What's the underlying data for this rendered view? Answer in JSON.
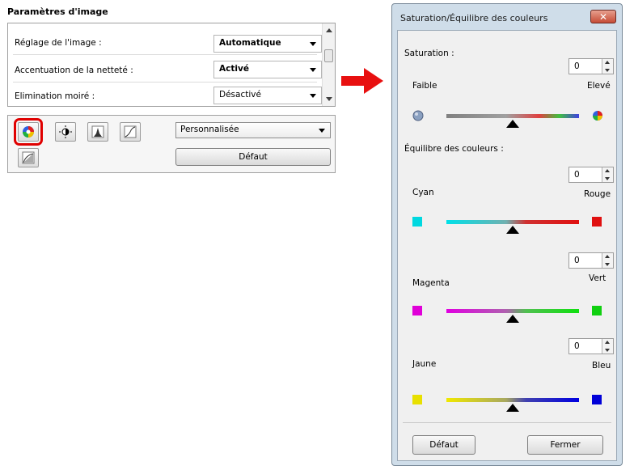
{
  "left_panel": {
    "title": "Paramètres d'image",
    "rows": [
      {
        "label": "Réglage de l'image :",
        "value": "Automatique"
      },
      {
        "label": "Accentuation de la netteté :",
        "value": "Activé"
      },
      {
        "label": "Elimination moiré :",
        "value": "Désactivé"
      }
    ],
    "tools": [
      "saturation-color-balance-icon",
      "brightness-contrast-icon",
      "histogram-icon",
      "tone-curve-icon",
      "final-review-icon"
    ],
    "preset_select": "Personnalisée",
    "default_button": "Défaut"
  },
  "dialog": {
    "title": "Saturation/Équilibre des couleurs",
    "saturation_label": "Saturation :",
    "saturation_value": "0",
    "low_label": "Faible",
    "high_label": "Elevé",
    "color_balance_label": "Équilibre des couleurs :",
    "balances": [
      {
        "left": "Cyan",
        "right": "Rouge",
        "value": "0",
        "left_color": "#00d8e0",
        "right_color": "#e01010"
      },
      {
        "left": "Magenta",
        "right": "Vert",
        "value": "0",
        "left_color": "#e000d8",
        "right_color": "#10d010"
      },
      {
        "left": "Jaune",
        "right": "Bleu",
        "value": "0",
        "left_color": "#e8e000",
        "right_color": "#0000d8"
      }
    ],
    "default_button": "Défaut",
    "close_button": "Fermer"
  },
  "colors": {
    "highlight": "#e00000",
    "dialog_frame": "#cfdde9"
  }
}
